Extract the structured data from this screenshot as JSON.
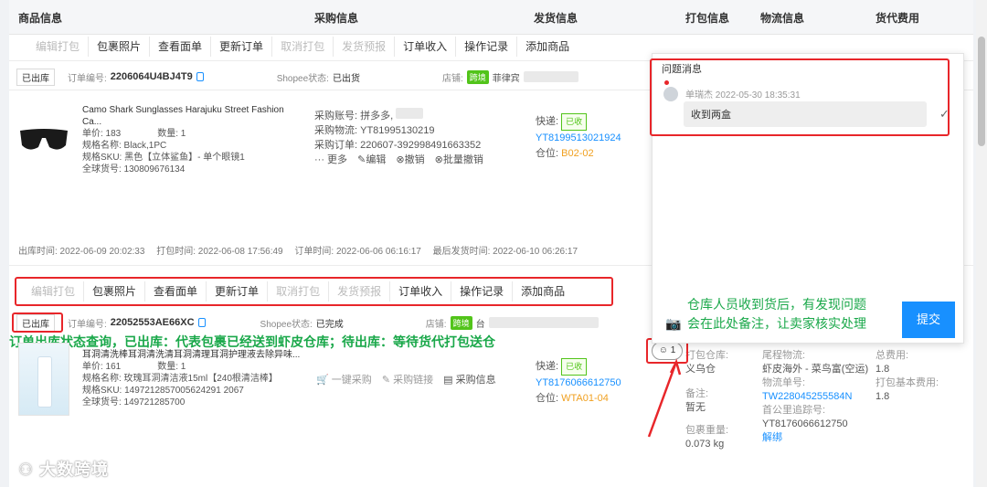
{
  "header": {
    "col_product": "商品信息",
    "col_purchase": "采购信息",
    "col_shipping": "发货信息",
    "col_packing": "打包信息",
    "col_logistics": "物流信息",
    "col_fee": "货代费用"
  },
  "toolbar": {
    "edit_pack": "编辑打包",
    "package_photo": "包裹照片",
    "view_sheet": "查看面单",
    "update_order": "更新订单",
    "cancel_pack": "取消打包",
    "ship_report": "发货预报",
    "order_income": "订单收入",
    "op_log": "操作记录",
    "add_product": "添加商品"
  },
  "order1": {
    "status": "已出库",
    "order_no_label": "订单编号:",
    "order_no": "2206064U4BJ4T9",
    "shopee_label": "Shopee状态:",
    "shopee_status": "已出货",
    "shop_label": "店铺:",
    "shop_tag": "跨境",
    "shop_name": "菲律宾",
    "product_name": "Camo Shark Sunglasses Harajuku Street Fashion Ca...",
    "unit_price": "单价: 183",
    "qty": "数量: 1",
    "spec": "规格名称: Black,1PC",
    "sku": "规格SKU: 黑色【立体鲨鱼】- 单个眼镜1",
    "global_no": "全球货号: 130809676134",
    "purchase_account": "采购账号: 拼多多,",
    "purchase_logistics": "采购物流: YT81995130219",
    "purchase_order": "采购订单: 220607-392998491663352",
    "more": "··· 更多",
    "edit": "编辑",
    "cancel": "撤销",
    "batch_cancel": "批量撤销",
    "express_label": "快递:",
    "express_tag": "已收",
    "tracking": "YT8199513021924",
    "warehouse_pos_label": "仓位:",
    "warehouse_pos": "B02-02",
    "out_time": "出库时间: 2022-06-09 20:02:33",
    "pack_time": "打包时间: 2022-06-08 17:56:49",
    "order_time": "订单时间: 2022-06-06 06:16:17",
    "last_ship_time": "最后发货时间: 2022-06-10 06:26:17"
  },
  "order2": {
    "status": "已出库",
    "order_no_label": "订单编号:",
    "order_no": "22052553AE66XC",
    "shopee_label": "Shopee状态:",
    "shopee_status": "已完成",
    "shop_label": "店铺:",
    "shop_tag": "跨境",
    "shop_name": "台",
    "product_name": "耳洞清洗棒耳洞清洗清耳洞清理耳洞护理液去除异味...",
    "unit_price": "单价: 161",
    "qty": "数量: 1",
    "spec": "规格名称: 玫瑰耳洞清洁液15ml【240根清洁棒】",
    "sku": "规格SKU: 1497212857005624291 2067",
    "global_no": "全球货号: 149721285700",
    "one_click_purchase": "一键采购",
    "purchase_link": "采购链接",
    "purchase_info": "采购信息",
    "express_label": "快递:",
    "express_tag": "已收",
    "tracking": "YT8176066612750",
    "warehouse_pos_label": "仓位:",
    "warehouse_pos": "WTA01-04",
    "pack_wh_label": "打包仓库:",
    "pack_wh": "义乌仓",
    "remark_label": "备注:",
    "remark": "暂无",
    "pkg_weight_label": "包裹重量:",
    "pkg_weight": "0.073 kg",
    "logistics_label": "尾程物流:",
    "logistics": "虾皮海外 - 菜鸟富(空运)",
    "logistics_no_label": "物流单号:",
    "logistics_no": "TW228045255584N",
    "first_mile_label": "首公里追踪号:",
    "first_mile": "YT8176066612750",
    "unbind": "解绑",
    "total_fee_label": "总费用:",
    "total_fee": "1.8",
    "pack_fee_label": "打包基本费用:",
    "pack_fee": "1.8"
  },
  "popup": {
    "title": "问题消息",
    "sender": "单瑞杰 2022-05-30 18:35:31",
    "message": "收到两盒",
    "submit": "提交"
  },
  "comment_count": "1",
  "annotations": {
    "status_note": "订单出库状态查询，已出库：代表包裹已经送到虾皮仓库；待出库：等待货代打包送仓",
    "warehouse_note_1": "仓库人员收到货后，有发现问题",
    "warehouse_note_2": "会在此处备注，让卖家核实处理"
  },
  "watermark": "大数跨境",
  "colors": {
    "annotation_green": "#1aa84a",
    "highlight_red": "#e8262a",
    "link_blue": "#1890ff",
    "submit_blue": "#1890ff"
  }
}
